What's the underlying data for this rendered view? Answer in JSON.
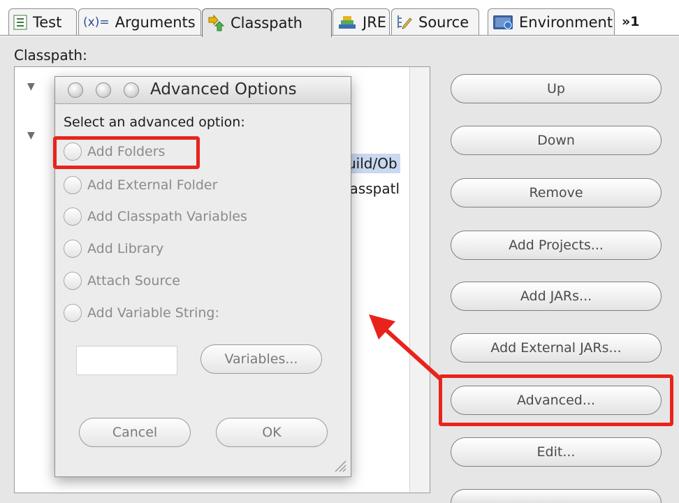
{
  "tabs": [
    {
      "label": "Test",
      "icon": "test-tab-icon"
    },
    {
      "label": "Arguments",
      "prefix": "(x)=",
      "icon": "arguments-tab-icon"
    },
    {
      "label": "Classpath",
      "icon": "classpath-tab-icon",
      "active": true
    },
    {
      "label": "JRE",
      "icon": "jre-tab-icon"
    },
    {
      "label": "Source",
      "icon": "source-tab-icon"
    },
    {
      "label": "Environment",
      "icon": "environment-tab-icon"
    },
    {
      "label": "»1",
      "icon": "overflow-tab-icon"
    }
  ],
  "classpath_label": "Classpath:",
  "tree": {
    "visible_fragment_1": "uild/Ob",
    "visible_fragment_2": "lasspatl"
  },
  "buttons": {
    "up": "Up",
    "down": "Down",
    "remove": "Remove",
    "add_projects": "Add Projects...",
    "add_jars": "Add JARs...",
    "add_external_jars": "Add External JARs...",
    "advanced": "Advanced...",
    "edit": "Edit..."
  },
  "dialog": {
    "title": "Advanced Options",
    "prompt": "Select an advanced option:",
    "options": [
      "Add Folders",
      "Add External Folder",
      "Add Classpath Variables",
      "Add Library",
      "Attach Source",
      "Add Variable String:"
    ],
    "variables_label": "Variables...",
    "cancel_label": "Cancel",
    "ok_label": "OK"
  },
  "colors": {
    "highlight": "#e8231c",
    "selection": "#c9d9f0"
  }
}
